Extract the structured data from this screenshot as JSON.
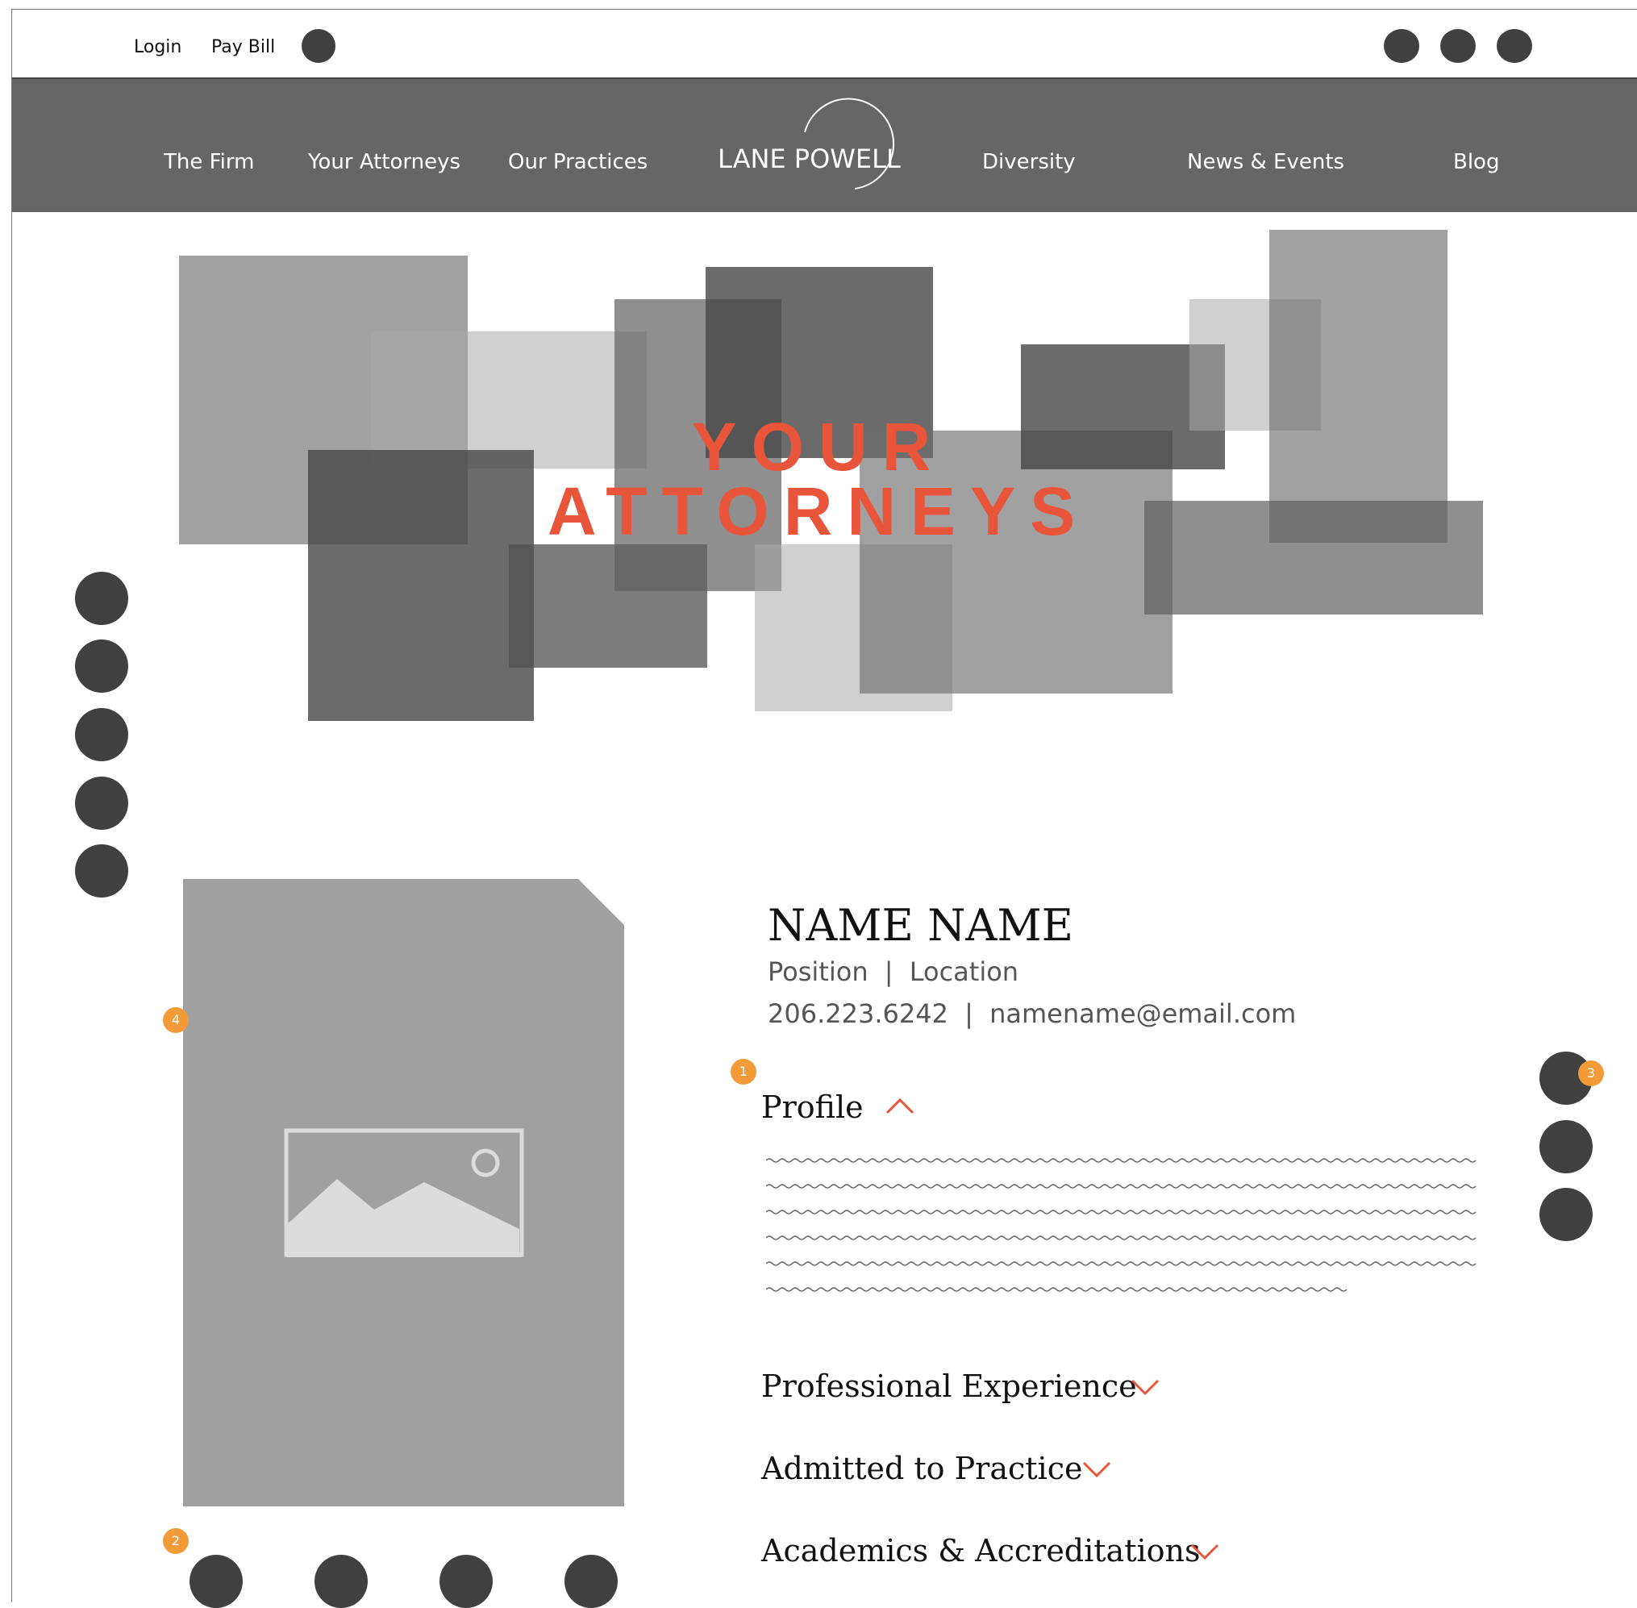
{
  "utility": {
    "login": "Login",
    "pay_bill": "Pay Bill"
  },
  "nav": {
    "items_left": [
      "The Firm",
      "Your Attorneys",
      "Our Practices"
    ],
    "logo": "LANE POWELL",
    "items_right": [
      "Diversity",
      "News & Events",
      "Blog"
    ]
  },
  "hero": {
    "title_line1": "YOUR",
    "title_line2": "ATTORNEYS"
  },
  "profile": {
    "name": "NAME NAME",
    "position": "Position",
    "location": "Location",
    "separator": "|",
    "phone": "206.223.6242",
    "email": "namename@email.com",
    "sections": [
      {
        "title": "Profile",
        "expanded": true
      },
      {
        "title": "Professional Experience",
        "expanded": false
      },
      {
        "title": "Admitted to Practice",
        "expanded": false
      },
      {
        "title": "Academics & Accreditations",
        "expanded": false
      }
    ]
  },
  "annotations": [
    "1",
    "2",
    "3",
    "4"
  ],
  "colors": {
    "accent": "#e8553a",
    "badge": "#f29b38",
    "nav_bg": "#666666",
    "dot": "#404040"
  }
}
